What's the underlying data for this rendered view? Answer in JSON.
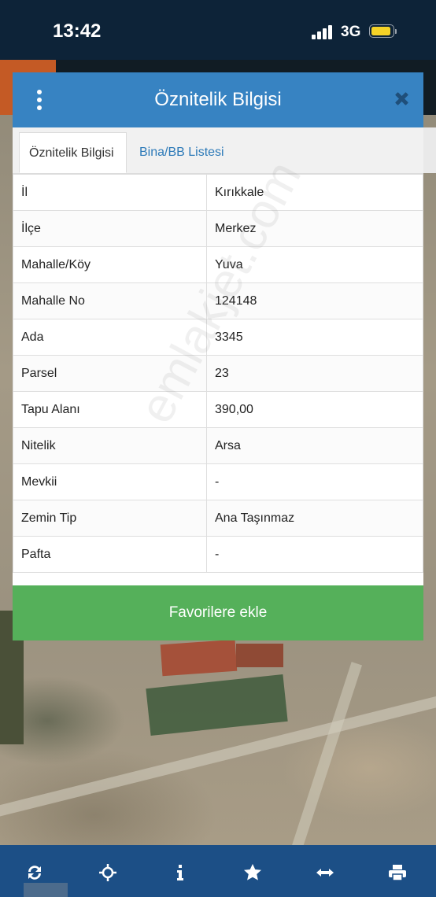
{
  "status_bar": {
    "time": "13:42",
    "network": "3G",
    "battery_level": 0.8,
    "battery_color": "#f5d327"
  },
  "dialog": {
    "title": "Öznitelik Bilgisi",
    "header_color": "#3783c2",
    "tabs": [
      {
        "label": "Öznitelik Bilgisi",
        "active": true
      },
      {
        "label": "Bina/BB Listesi",
        "active": false
      }
    ],
    "rows": [
      {
        "key": "İl",
        "value": "Kırıkkale"
      },
      {
        "key": "İlçe",
        "value": "Merkez"
      },
      {
        "key": "Mahalle/Köy",
        "value": "Yuva"
      },
      {
        "key": "Mahalle No",
        "value": "124148"
      },
      {
        "key": "Ada",
        "value": "3345"
      },
      {
        "key": "Parsel",
        "value": "23"
      },
      {
        "key": "Tapu Alanı",
        "value": "390,00"
      },
      {
        "key": "Nitelik",
        "value": "Arsa"
      },
      {
        "key": "Mevkii",
        "value": "-"
      },
      {
        "key": "Zemin Tip",
        "value": "Ana Taşınmaz"
      },
      {
        "key": "Pafta",
        "value": "-"
      }
    ],
    "favorite_button": "Favorilere ekle",
    "favorite_color": "#55b05a"
  },
  "watermark": "emlakjet.com",
  "toolbar": {
    "color": "#1c4f86",
    "icons": [
      "refresh-icon",
      "locate-icon",
      "info-icon",
      "star-icon",
      "measure-icon",
      "print-icon"
    ]
  }
}
